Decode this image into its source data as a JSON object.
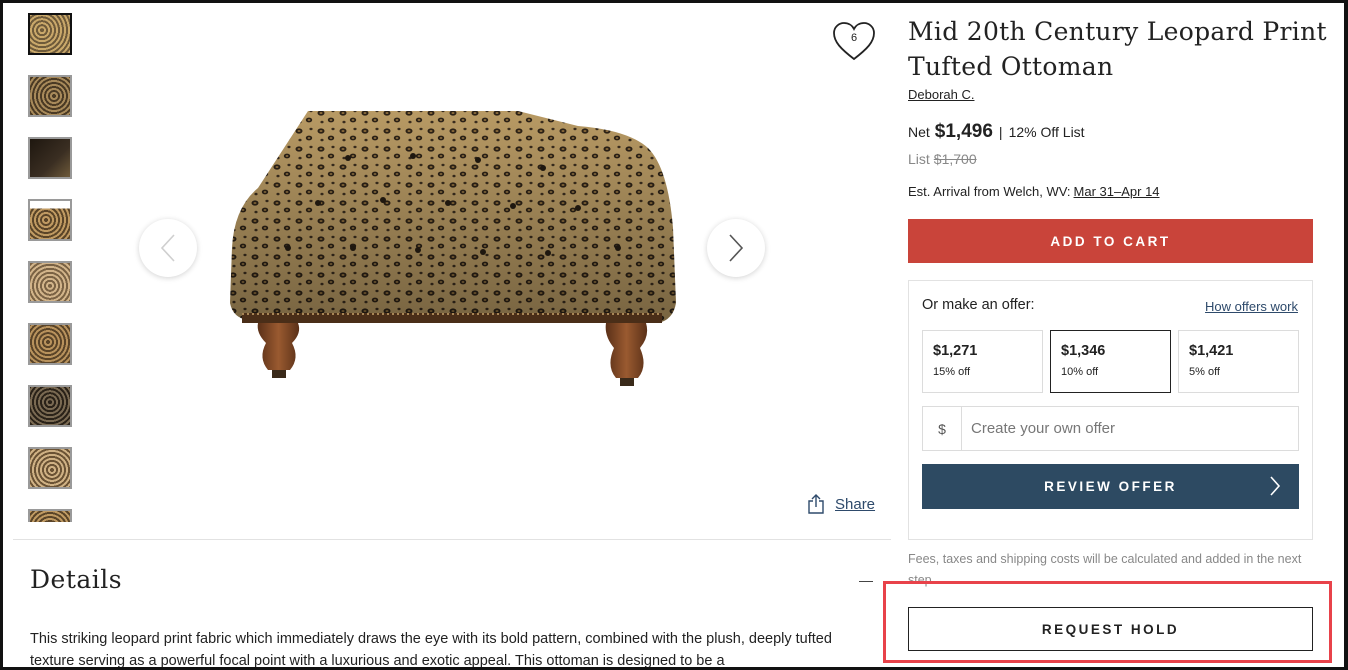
{
  "gallery": {
    "thumbnails": [
      {
        "name": "thumb-1",
        "color": "#6e5a3a"
      },
      {
        "name": "thumb-2",
        "color": "#7a6a52"
      },
      {
        "name": "thumb-3",
        "color": "#2a2218"
      },
      {
        "name": "thumb-4",
        "color": "#8a6a46"
      },
      {
        "name": "thumb-5",
        "color": "#9a8262"
      },
      {
        "name": "thumb-6",
        "color": "#7c6444"
      },
      {
        "name": "thumb-7",
        "color": "#4a3e30"
      },
      {
        "name": "thumb-8",
        "color": "#8e7656"
      },
      {
        "name": "thumb-9",
        "color": "#6e5a3a"
      }
    ],
    "favorite_count": "6",
    "share_label": "Share"
  },
  "product": {
    "title": "Mid 20th Century Leopard Print Tufted Ottoman",
    "seller": "Deborah C.",
    "net_label": "Net",
    "net_price": "$1,496",
    "separator": "|",
    "discount_text": "12% Off List",
    "list_label": "List",
    "list_price": "$1,700",
    "arrival_label": "Est. Arrival from Welch, WV:",
    "arrival_dates": "Mar 31–Apr 14"
  },
  "actions": {
    "add_to_cart": "ADD TO CART",
    "review_offer": "REVIEW OFFER",
    "request_hold": "REQUEST HOLD"
  },
  "offer": {
    "heading": "Or make an offer:",
    "how_offers_link": "How offers work",
    "options": [
      {
        "amount": "$1,271",
        "percent": "15% off",
        "selected": false
      },
      {
        "amount": "$1,346",
        "percent": "10% off",
        "selected": true
      },
      {
        "amount": "$1,421",
        "percent": "5% off",
        "selected": false
      }
    ],
    "currency_symbol": "$",
    "custom_placeholder": "Create your own offer"
  },
  "fees_note": "Fees, taxes and shipping costs will be calculated and added in the next step.",
  "details": {
    "heading": "Details",
    "text": "This striking leopard print fabric which immediately draws the eye with its bold pattern, combined with the plush, deeply tufted texture serving as a powerful focal point with a luxurious and exotic appeal. This ottoman is designed to be a"
  },
  "colors": {
    "add_to_cart_bg": "#c9443a",
    "review_offer_bg": "#2d4a62",
    "link": "#2e4a6b",
    "highlight_border": "#e8424a"
  }
}
